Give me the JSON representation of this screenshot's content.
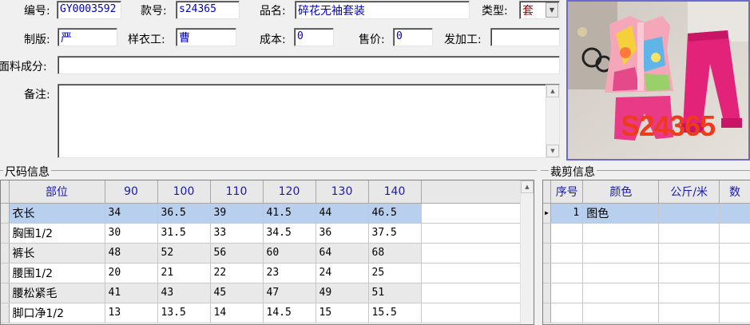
{
  "form": {
    "code_label": "编号:",
    "code_value": "GY0003592",
    "style_label": "款号:",
    "style_value": "s24365",
    "name_label": "品名:",
    "name_value": "碎花无袖套装",
    "type_label": "类型:",
    "type_value": "套",
    "pattern_label": "制版:",
    "pattern_value": "严",
    "sample_label": "样衣工:",
    "sample_value": "曹",
    "cost_label": "成本:",
    "cost_value": "0",
    "price_label": "售价:",
    "price_value": "0",
    "outsource_label": "发加工:",
    "outsource_value": "",
    "fabric_label": "面料成分:",
    "fabric_value": "",
    "remark_label": "备注:",
    "remark_value": ""
  },
  "photo": {
    "overlay_text": "S24365",
    "overlay_color": "#f03a1e"
  },
  "size_panel": {
    "title": "尺码信息",
    "columns": [
      "部位",
      "90",
      "100",
      "110",
      "120",
      "130",
      "140"
    ],
    "rows": [
      [
        "衣长",
        "34",
        "36.5",
        "39",
        "41.5",
        "44",
        "46.5"
      ],
      [
        "胸围1/2",
        "30",
        "31.5",
        "33",
        "34.5",
        "36",
        "37.5"
      ],
      [
        "裤长",
        "48",
        "52",
        "56",
        "60",
        "64",
        "68"
      ],
      [
        "腰围1/2",
        "20",
        "21",
        "22",
        "23",
        "24",
        "25"
      ],
      [
        "腰松紧毛",
        "41",
        "43",
        "45",
        "47",
        "49",
        "51"
      ],
      [
        "脚口净1/2",
        "13",
        "13.5",
        "14",
        "14.5",
        "15",
        "15.5"
      ]
    ],
    "selected_row": 0
  },
  "cut_panel": {
    "title": "裁剪信息",
    "columns": [
      "序号",
      "颜色",
      "公斤/米",
      "数"
    ],
    "rows": [
      [
        "1",
        "图色",
        "",
        ""
      ]
    ]
  },
  "colors": {
    "value_text": "#0000c8",
    "header_text": "#1a1ab0",
    "selected_row": "#b8d0ee",
    "photo_border": "#6a6ad0"
  }
}
